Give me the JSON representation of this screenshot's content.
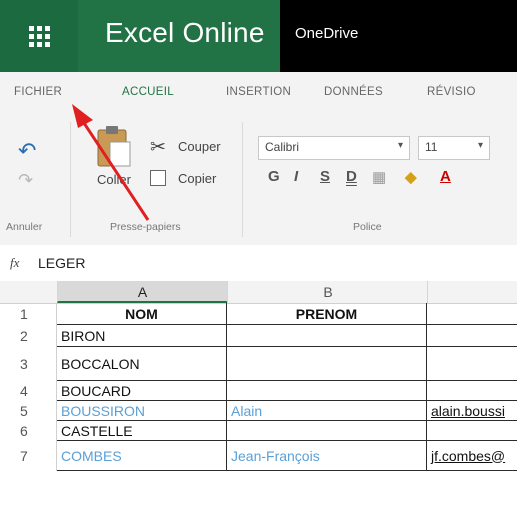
{
  "app": {
    "title": "Excel Online",
    "service": "OneDrive"
  },
  "tabs": [
    {
      "label": "FICHIER"
    },
    {
      "label": "ACCUEIL"
    },
    {
      "label": "INSERTION"
    },
    {
      "label": "DONNÉES"
    },
    {
      "label": "RÉVISIO"
    }
  ],
  "ribbon": {
    "undo_group": "Annuler",
    "clipboard_group": "Presse-papiers",
    "font_group": "Police",
    "paste_label": "Coller",
    "cut_label": "Couper",
    "copy_label": "Copier",
    "font_name": "Calibri",
    "font_size": "11",
    "bold": "G",
    "italic": "I",
    "underline": "S",
    "double_underline": "D",
    "font_color": "A"
  },
  "formula_bar": {
    "fx": "fx",
    "value": "LEGER"
  },
  "columns": [
    "A",
    "B"
  ],
  "rows": [
    {
      "num": "1",
      "a": "NOM",
      "b": "PRENOM",
      "c": ""
    },
    {
      "num": "2",
      "a": "BIRON",
      "b": "",
      "c": ""
    },
    {
      "num": "3",
      "a": "BOCCALON",
      "b": "",
      "c": ""
    },
    {
      "num": "4",
      "a": "BOUCARD",
      "b": "",
      "c": ""
    },
    {
      "num": "5",
      "a": "BOUSSIRON",
      "b": "Alain",
      "c": "alain.boussi"
    },
    {
      "num": "6",
      "a": "CASTELLE",
      "b": "",
      "c": ""
    },
    {
      "num": "7",
      "a": "COMBES",
      "b": "Jean-François",
      "c": "jf.combes@"
    }
  ],
  "colors": {
    "excel_green": "#217346",
    "link_blue": "#5aa0d6",
    "arrow_red": "#e02020"
  }
}
